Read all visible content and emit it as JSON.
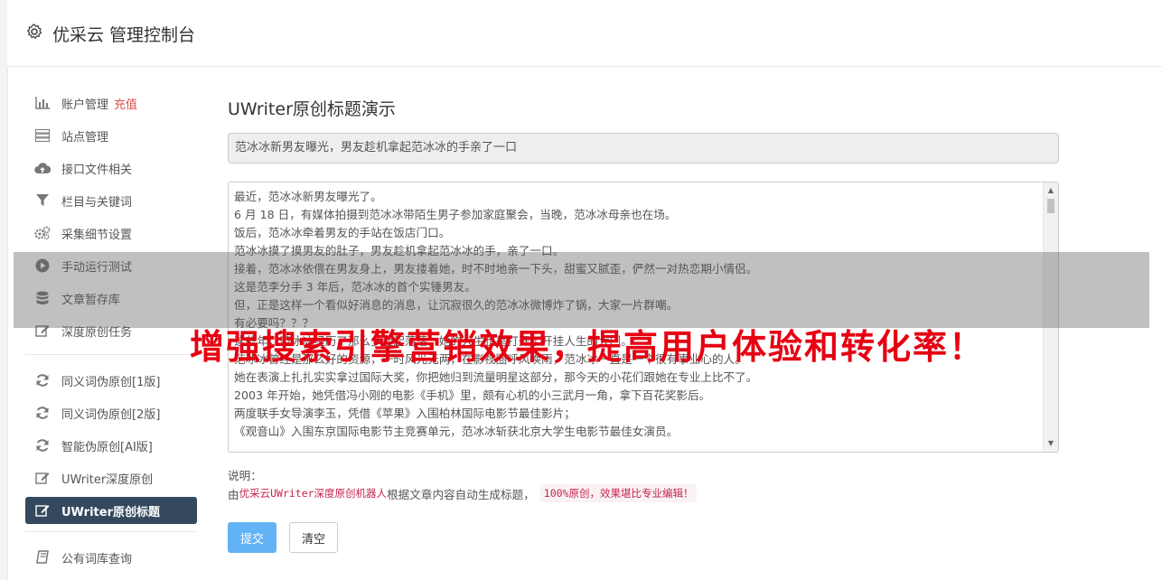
{
  "header": {
    "title": "优采云 管理控制台",
    "icon": "gear-icon"
  },
  "sidebar": {
    "items": [
      {
        "label": "账户管理",
        "badge": "充值",
        "icon": "bar-chart-icon"
      },
      {
        "label": "站点管理",
        "icon": "server-icon"
      },
      {
        "label": "接口文件相关",
        "icon": "cloud-upload-icon"
      },
      {
        "label": "栏目与关键词",
        "icon": "filter-icon"
      },
      {
        "label": "采集细节设置",
        "icon": "cogs-icon"
      },
      {
        "label": "手动运行测试",
        "icon": "play-circle-icon"
      },
      {
        "label": "文章暂存库",
        "icon": "database-icon"
      },
      {
        "label": "深度原创任务",
        "icon": "edit-icon"
      }
    ],
    "items2": [
      {
        "label": "同义词伪原创[1版]",
        "icon": "refresh-icon"
      },
      {
        "label": "同义词伪原创[2版]",
        "icon": "refresh-icon"
      },
      {
        "label": "智能伪原创[AI版]",
        "icon": "refresh-icon"
      },
      {
        "label": "UWriter深度原创",
        "icon": "edit-icon"
      },
      {
        "label": "UWriter原创标题",
        "icon": "edit-icon",
        "active": true
      }
    ],
    "items3": [
      {
        "label": "公有词库查询",
        "icon": "book-icon"
      }
    ]
  },
  "main": {
    "title": "UWriter原创标题演示",
    "title_input_value": "范冰冰新男友曝光，男友趁机拿起范冰冰的手亲了一口",
    "content_lines": [
      "最近，范冰冰新男友曝光了。",
      "6 月 18 日，有媒体拍摄到范冰冰带陌生男子参加家庭聚会，当晚，范冰冰母亲也在场。",
      "饭后，范冰冰牵着男友的手站在饭店门口。",
      "范冰冰摸了摸男友的肚子，男友趁机拿起范冰冰的手，亲了一口。",
      "接着，范冰冰依偎在男友身上，男友搂着她，时不时地亲一下头，甜蜜又腻歪，俨然一对热恋期小情侣。",
      "这是范李分手 3 年后，范冰冰的首个实锤男友。",
      "但，正是这样一个看似好消息的消息，让沉寂很久的范冰冰微博炸了锅，大家一片群嘲。",
      "有必要吗？？？",
      "这些年，范冰冰经历了那么多起起落落，她的人生也是打开了开挂人生的大门。",
      "范冰冰曾经是那么好的资源，一时风光无两，在影视圈呼风唤雨，范冰冰一直是一个很有事业心的人。",
      "她在表演上扎扎实实拿过国际大奖，你把她归到流量明星这部分，那今天的小花们跟她在专业上比不了。",
      "2003 年开始，她凭借冯小刚的电影《手机》里，颇有心机的小三武月一角，拿下百花奖影后。",
      "两度联手女导演李玉，凭借《苹果》入围柏林国际电影节最佳影片；",
      "《观音山》入围东京国际电影节主竞赛单元，范冰冰斩获北京大学生电影节最佳女演员。"
    ],
    "note_label": "说明：",
    "note_prefix": "由 ",
    "note_code": "优采云UWriter深度原创机器人",
    "note_middle": " 根据文章内容自动生成标题，",
    "note_highlight": "100%原创，效果堪比专业编辑！",
    "submit_label": "提交",
    "clear_label": "清空"
  },
  "overlay": {
    "text": "增强搜索引擎营销效果，提高用户体验和转化率！"
  }
}
